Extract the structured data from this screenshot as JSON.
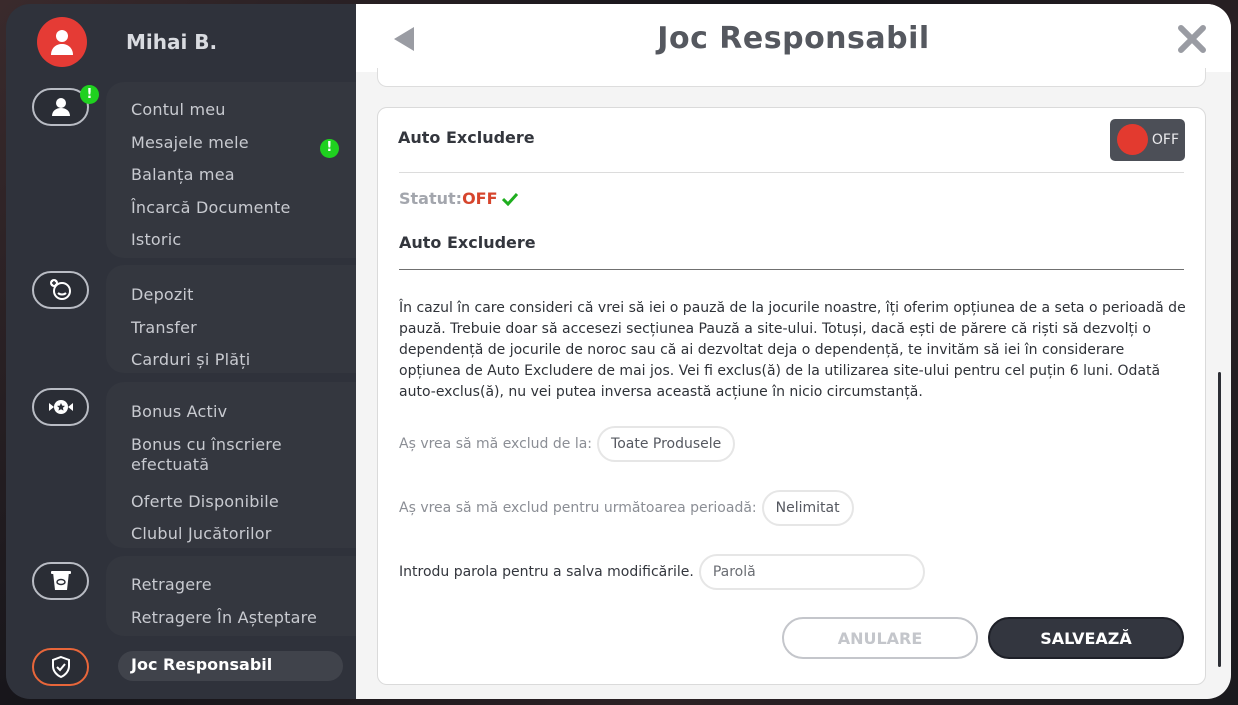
{
  "user": {
    "name": "Mihai B."
  },
  "nav": {
    "account": {
      "items": [
        "Contul meu",
        "Mesajele mele",
        "Balanța mea",
        "Încarcă Documente",
        "Istoric"
      ],
      "badge": "!"
    },
    "payments": {
      "items": [
        "Depozit",
        "Transfer",
        "Carduri și Plăți"
      ]
    },
    "bonus": {
      "items": [
        "Bonus Activ",
        "Bonus cu înscriere efectuată",
        "Oferte Disponibile",
        "Clubul Jucătorilor"
      ]
    },
    "withdraw": {
      "items": [
        "Retragere",
        "Retragere În Așteptare"
      ]
    },
    "responsible": {
      "label": "Joc Responsabil"
    }
  },
  "header": {
    "title": "Joc Responsabil"
  },
  "card": {
    "title": "Auto Excludere",
    "toggle_label": "OFF",
    "status_label": "Statut:",
    "status_value": "OFF",
    "section_title": "Auto Excludere",
    "description": "În cazul în care consideri că vrei să iei o pauză de la jocurile noastre, îți oferim opțiunea de a seta o perioadă de pauză. Trebuie doar să accesezi secțiunea Pauză a site-ului. Totuși, dacă ești de părere că riști să dezvolți o dependență de jocurile de noroc sau că ai dezvoltat deja o dependență, te invităm să iei în considerare opțiunea de Auto Excludere de mai jos. Vei fi exclus(ă) de la utilizarea site-ului pentru cel puțin 6 luni. Odată auto-exclus(ă), nu vei putea inversa această acțiune în nicio circumstanță.",
    "exclude_from_label": "Aș vrea să mă exclud de la:",
    "exclude_from_value": "Toate Produsele",
    "period_label": "Aș vrea să mă exclud pentru următoarea perioadă:",
    "period_value": "Nelimitat",
    "password_label": "Introdu parola pentru a salva modificările.",
    "password_placeholder": "Parolă",
    "cancel_label": "ANULARE",
    "save_label": "SALVEAZĂ"
  },
  "colors": {
    "accent": "#e53b35",
    "badge": "#1fd11f",
    "status_off": "#d6452d",
    "check": "#1fae1f"
  }
}
